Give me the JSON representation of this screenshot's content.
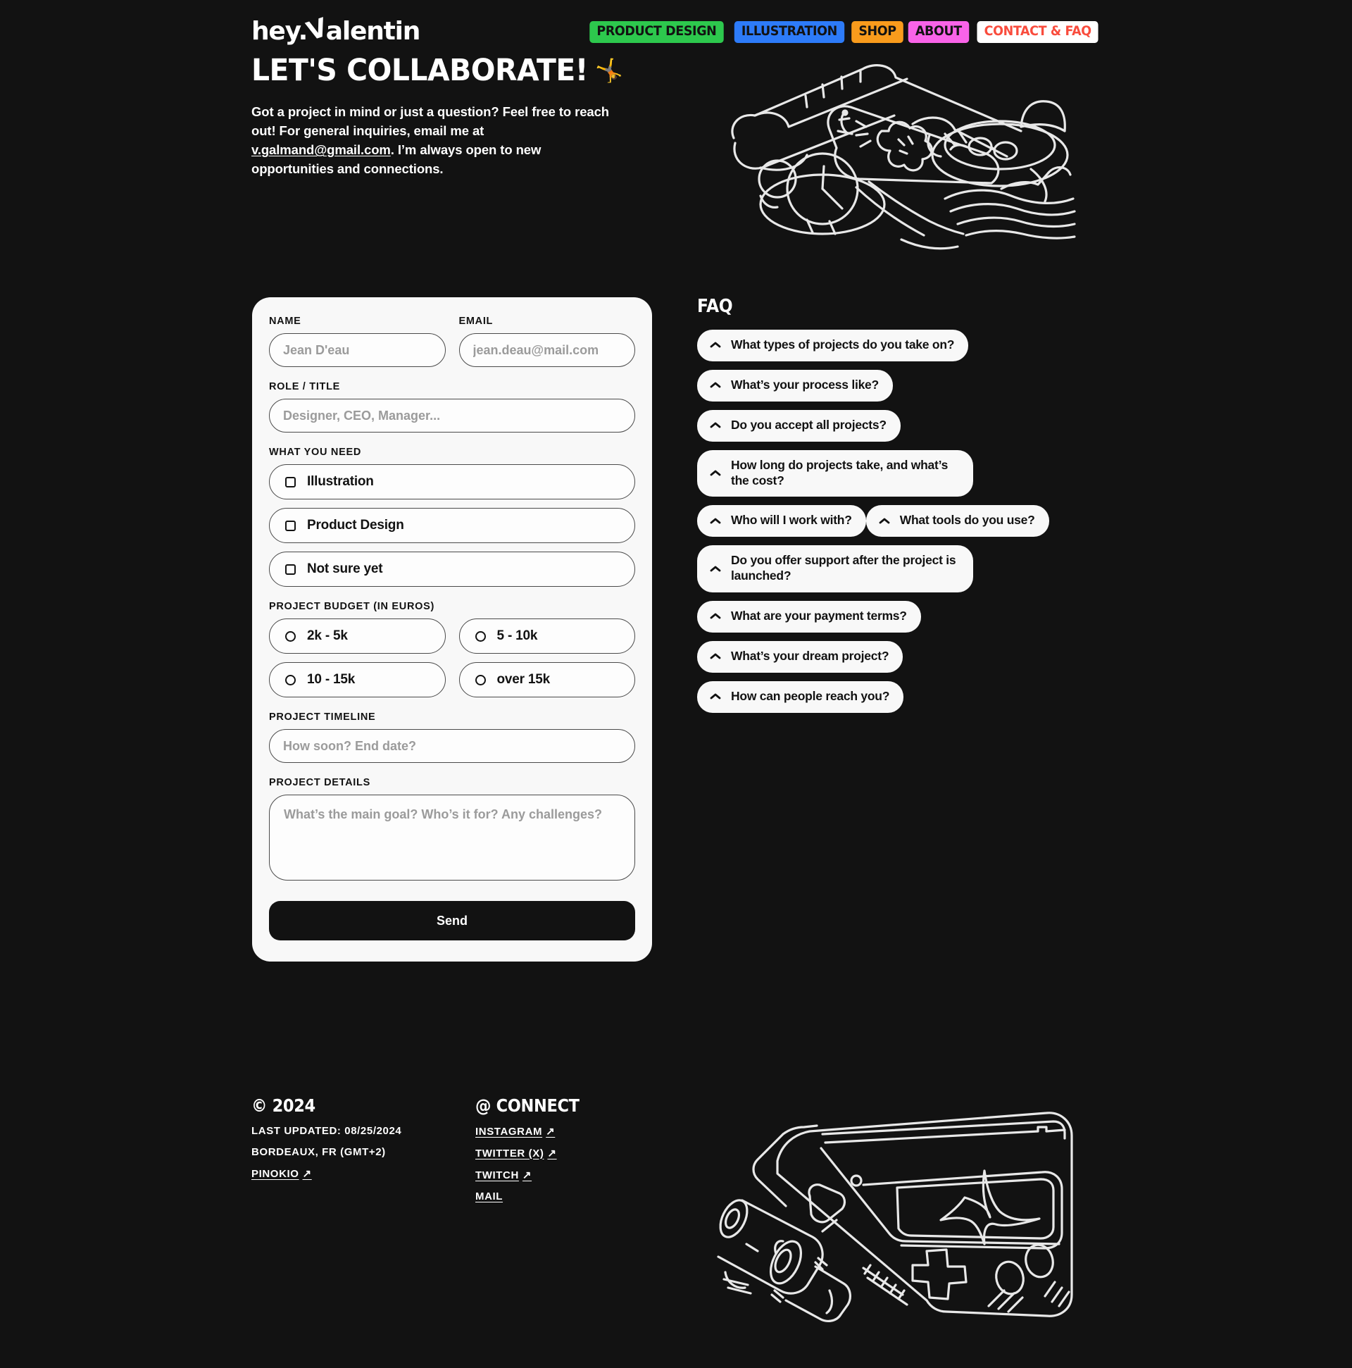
{
  "brand": {
    "logo_prefix": "hey.",
    "logo_mark": "V",
    "logo_suffix": "alentin"
  },
  "nav": {
    "items": [
      {
        "label": "PRODUCT DESIGN",
        "bg": "#2DC84D",
        "fg": "#121212"
      },
      {
        "label": "ILLUSTRATION",
        "bg": "#2D7BF9",
        "fg": "#121212"
      },
      {
        "label": "SHOP",
        "bg": "#F99B1C",
        "fg": "#121212"
      },
      {
        "label": "ABOUT",
        "bg": "#F963E8",
        "fg": "#121212"
      },
      {
        "label": "CONTACT & FAQ",
        "bg": "#FFFFFF",
        "fg": "#F94C3D"
      }
    ]
  },
  "hero": {
    "title": "LET'S COLLABORATE!",
    "emoji": "🤸",
    "paragraph_before": "Got a project in mind or just a question? Feel free to reach out! For general inquiries, email me at ",
    "email": "v.galmand@gmail.com",
    "paragraph_after": ". I’m always open to new opportunities and connections."
  },
  "form": {
    "name_label": "NAME",
    "name_placeholder": "Jean D'eau",
    "email_label": "EMAIL",
    "email_placeholder": "jean.deau@mail.com",
    "role_label": "ROLE / TITLE",
    "role_placeholder": "Designer, CEO, Manager...",
    "need_label": "WHAT YOU NEED",
    "need_options": [
      "Illustration",
      "Product Design",
      "Not sure yet"
    ],
    "budget_label": "PROJECT BUDGET (IN EUROS)",
    "budget_options": [
      "2k - 5k",
      "5 - 10k",
      "10 - 15k",
      "over 15k"
    ],
    "timeline_label": "PROJECT TIMELINE",
    "timeline_placeholder": "How soon? End date?",
    "details_label": "PROJECT DETAILS",
    "details_placeholder": "What’s the main goal? Who’s it for? Any challenges?",
    "send_label": "Send"
  },
  "faq": {
    "title": "FAQ",
    "items": [
      "What types of projects do you take on?",
      "What’s your process like?",
      "Do you accept all projects?",
      "How long do projects take, and what’s the cost?",
      "Who will I work with?",
      "What tools do you use?",
      "Do you offer support after the project is launched?",
      "What are your payment terms?",
      "What’s your dream project?",
      "How can people reach you?"
    ]
  },
  "footer": {
    "copyright": "© 2024",
    "last_updated": "LAST UPDATED: 08/25/2024",
    "location": "BORDEAUX, FR (GMT+2)",
    "pinokio": "PINOKIO",
    "connect_title": "@ CONNECT",
    "links": [
      {
        "label": "INSTAGRAM",
        "external": true
      },
      {
        "label": "TWITTER (X)",
        "external": true
      },
      {
        "label": "TWITCH",
        "external": true
      },
      {
        "label": "MAIL",
        "external": false
      }
    ]
  }
}
